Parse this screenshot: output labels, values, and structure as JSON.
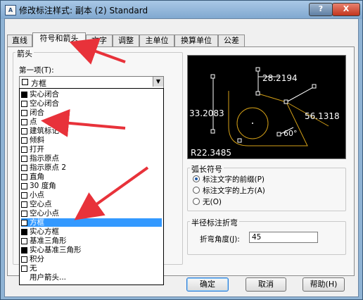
{
  "window": {
    "title": "修改标注样式: 副本 (2) Standard",
    "icon_text": "A",
    "help_label": "?",
    "close_label": "X"
  },
  "tabs": [
    "直线",
    "符号和箭头",
    "文字",
    "调整",
    "主单位",
    "换算单位",
    "公差"
  ],
  "active_tab": "符号和箭头",
  "arrows_group": {
    "label": "箭头",
    "first_label": "第一项(T):",
    "first_value": "方框"
  },
  "dropdown_items": [
    {
      "label": "实心闭合",
      "icon": "solid-closed-arrow"
    },
    {
      "label": "空心闭合",
      "icon": "hollow-closed-arrow"
    },
    {
      "label": "闭合",
      "icon": "closed-arrow"
    },
    {
      "label": "点",
      "icon": "dot-arrow"
    },
    {
      "label": "建筑标记",
      "icon": "arch-tick-arrow"
    },
    {
      "label": "倾斜",
      "icon": "oblique-arrow"
    },
    {
      "label": "打开",
      "icon": "open-arrow"
    },
    {
      "label": "指示原点",
      "icon": "origin-indicator-arrow"
    },
    {
      "label": "指示原点 2",
      "icon": "origin-indicator-2-arrow"
    },
    {
      "label": "直角",
      "icon": "right-angle-arrow"
    },
    {
      "label": "30 度角",
      "icon": "open-30-arrow"
    },
    {
      "label": "小点",
      "icon": "dot-small-arrow"
    },
    {
      "label": "空心点",
      "icon": "dot-blank-arrow"
    },
    {
      "label": "空心小点",
      "icon": "dot-small-blank-arrow"
    },
    {
      "label": "方框",
      "icon": "box-blank-arrow"
    },
    {
      "label": "实心方框",
      "icon": "box-filled-arrow"
    },
    {
      "label": "基准三角形",
      "icon": "datum-blank-arrow"
    },
    {
      "label": "实心基准三角形",
      "icon": "datum-filled-arrow"
    },
    {
      "label": "积分",
      "icon": "integral-arrow"
    },
    {
      "label": "无",
      "icon": "none-arrow"
    },
    {
      "label": "用户箭头...",
      "icon": ""
    }
  ],
  "selected_item": "方框",
  "preview": {
    "dim_top": "28.2194",
    "dim_left": "33.2083",
    "dim_right": "56.1318",
    "angle": "60°",
    "radius": "R22.3485"
  },
  "arc_length": {
    "label": "弧长符号",
    "options": [
      "标注文字的前缀(P)",
      "标注文字的上方(A)",
      "无(O)"
    ],
    "selected": 0
  },
  "jog": {
    "label": "半径标注折弯",
    "angle_label": "折弯角度(J):",
    "angle_value": "45"
  },
  "buttons": {
    "ok": "确定",
    "cancel": "取消",
    "help": "帮助(H)"
  },
  "colors": {
    "annotation_arrow": "#e8323a",
    "selection": "#3399ff",
    "preview_line": "#d4a017"
  }
}
